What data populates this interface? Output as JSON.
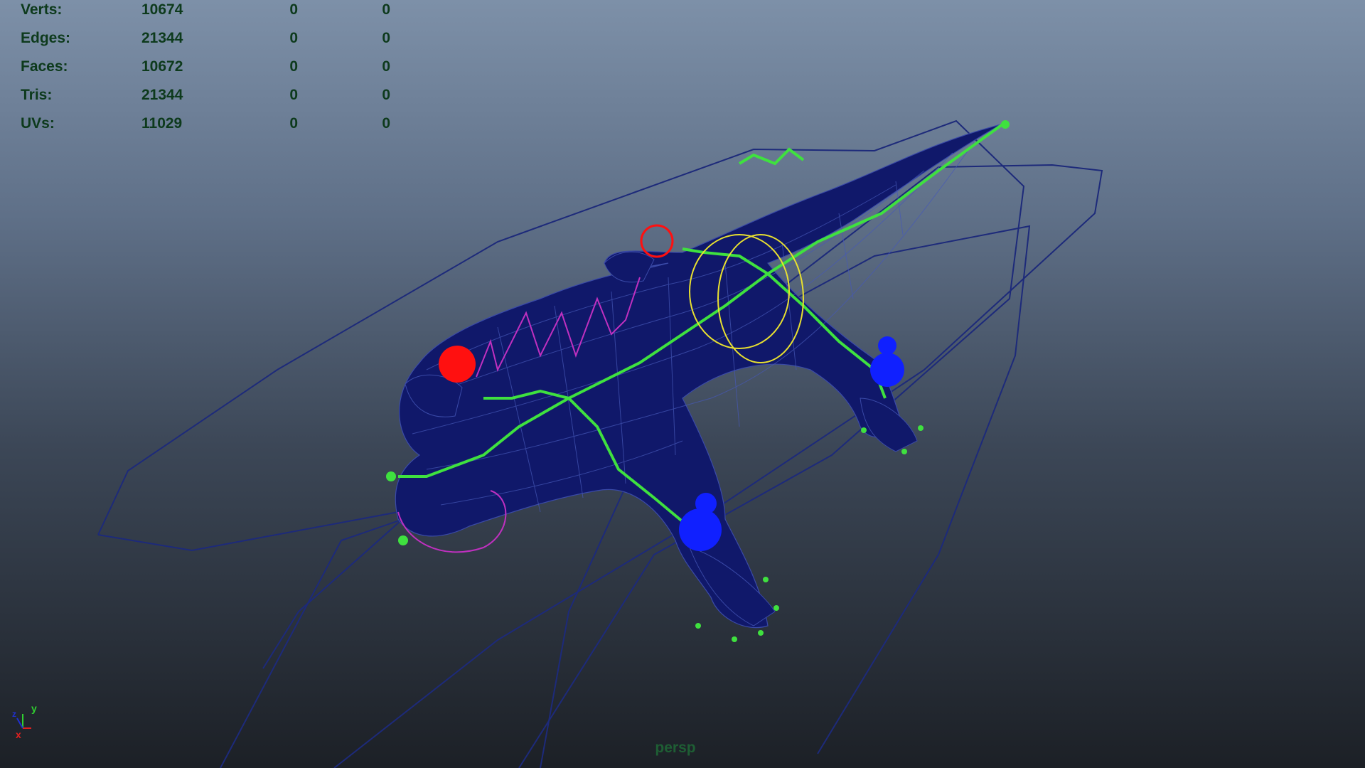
{
  "hud": {
    "rows": [
      {
        "label": "Verts:",
        "total": "10674",
        "selected": "0",
        "component": "0"
      },
      {
        "label": "Edges:",
        "total": "21344",
        "selected": "0",
        "component": "0"
      },
      {
        "label": "Faces:",
        "total": "10672",
        "selected": "0",
        "component": "0"
      },
      {
        "label": "Tris:",
        "total": "21344",
        "selected": "0",
        "component": "0"
      },
      {
        "label": "UVs:",
        "total": "11029",
        "selected": "0",
        "component": "0"
      }
    ]
  },
  "axis": {
    "y_label": "y",
    "x_label": "x",
    "z_label": "z"
  },
  "camera": {
    "name": "persp"
  },
  "colors": {
    "mesh": "#10186a",
    "wire": "#2a3a8a",
    "joint": "#3fe13f",
    "ik_red": "#ff1010",
    "ik_blue": "#1020ff",
    "curve_magenta": "#c030c0",
    "curve_yellow": "#e8e030",
    "hud_text": "#0d3a1c"
  }
}
